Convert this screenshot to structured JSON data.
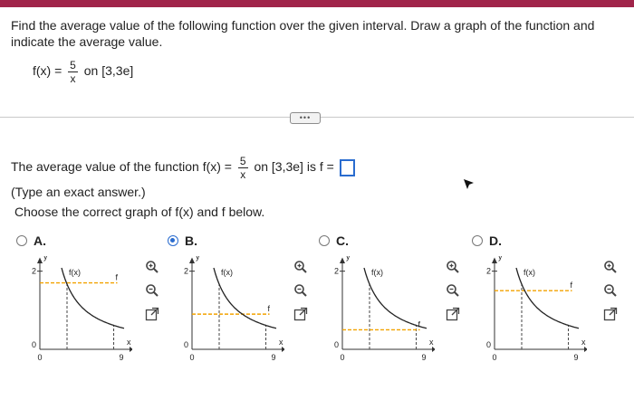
{
  "question": {
    "text": "Find the average value of the following function over the given interval. Draw a graph of the function and indicate the average value.",
    "function_lhs": "f(x) =",
    "numerator": "5",
    "denominator": "x",
    "interval": "on [3,3e]"
  },
  "expand_button_label": "•••",
  "answer": {
    "prefix": "The average value of the function f(x) =",
    "numerator": "5",
    "denominator": "x",
    "suffix": "on [3,3e] is f =",
    "input_value": ""
  },
  "hint": "(Type an exact answer.)",
  "instruction": "Choose the correct graph of f(x) and f below.",
  "options": [
    {
      "label": "A.",
      "selected": false
    },
    {
      "label": "B.",
      "selected": true
    },
    {
      "label": "C.",
      "selected": false
    },
    {
      "label": "D.",
      "selected": false
    }
  ],
  "graphs": [
    {
      "y_label": "y",
      "y_top": "2",
      "y_zero": "0",
      "x_zero": "0",
      "x_max": "9",
      "x_label": "x",
      "curve_label": "f(x)",
      "avg_label": "f",
      "average_level": 1.7
    },
    {
      "y_label": "y",
      "y_top": "2",
      "y_zero": "0",
      "x_zero": "0",
      "x_max": "9",
      "x_label": "x",
      "curve_label": "f(x)",
      "avg_label": "f",
      "average_level": 0.9
    },
    {
      "y_label": "y",
      "y_top": "2",
      "y_zero": "0",
      "x_zero": "0",
      "x_max": "9",
      "x_label": "x",
      "curve_label": "f(x)",
      "avg_label": "f",
      "average_level": 0.5
    },
    {
      "y_label": "y",
      "y_top": "2",
      "y_zero": "0",
      "x_zero": "0",
      "x_max": "9",
      "x_label": "x",
      "curve_label": "f(x)",
      "avg_label": "f",
      "average_level": 1.5
    }
  ],
  "icons": [
    "zoom-in-icon",
    "zoom-out-icon",
    "expand-graph-icon"
  ],
  "colors": {
    "accent": "#2a6ccf",
    "brand_bar": "#a0244a",
    "average_line": "#f2a200"
  }
}
